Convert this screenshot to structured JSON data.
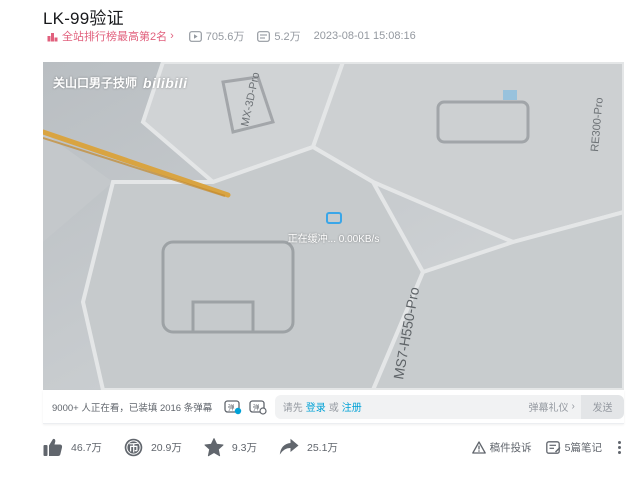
{
  "video": {
    "title": "LK-99验证",
    "rank_label": "全站排行榜最高第2名",
    "views": "705.6万",
    "danmaku_count": "5.2万",
    "publish_time": "2023-08-01 15:08:16"
  },
  "player": {
    "watermark_user": "关山口男子技师",
    "watermark_logo": "bilibili",
    "buffer_text": "正在缓冲... 0.00KB/s",
    "scene_text": {
      "model_a": "MX-3D-Pro",
      "model_b": "RE300-Pro",
      "model_c": "MS7-H550-Pro"
    }
  },
  "danmaku_bar": {
    "viewer_text": "9000+ 人正在看，已装填 2016 条弹幕",
    "input_prefix": "请先",
    "login": "登录",
    "or": "或",
    "register": "注册",
    "etiquette": "弹幕礼仪",
    "send": "发送"
  },
  "toolbar": {
    "like": "46.7万",
    "coin": "20.9万",
    "favorite": "9.3万",
    "share": "25.1万",
    "report": "稿件投诉",
    "notes": "5篇笔记"
  },
  "colors": {
    "accent_pink": "#e1607d",
    "link_blue": "#00a1d6",
    "text_gray": "#61666d"
  }
}
